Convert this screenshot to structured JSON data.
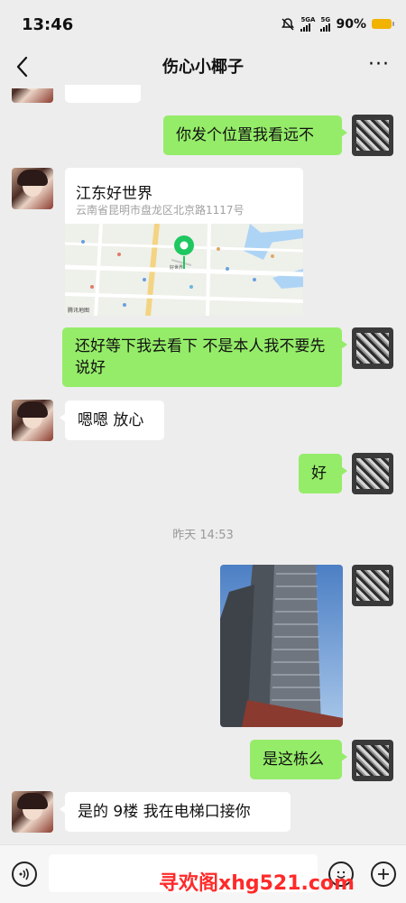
{
  "status_bar": {
    "time": "13:46",
    "network1": "5GA",
    "network2": "5G",
    "battery": "90%"
  },
  "header": {
    "title": "伤心小椰子",
    "more": "···"
  },
  "messages": {
    "m1": "你发个位置我看远不",
    "location": {
      "name": "江东好世界",
      "address": "云南省昆明市盘龙区北京路1117号",
      "map_labels": [
        "腾讯地图",
        "好世界"
      ]
    },
    "m2": "还好等下我去看下  不是本人我不要先说好",
    "m3": "嗯嗯 放心",
    "m4": "好",
    "timestamp": "昨天 14:53",
    "m5": "是这栋么",
    "m6": "是的  9楼 我在电梯口接你"
  },
  "watermark": "寻欢阁xhg521.com",
  "colors": {
    "sent_bubble": "#95ec69",
    "received_bubble": "#ffffff",
    "background": "#ededed",
    "watermark": "#ff2a2a",
    "map_pin": "#1ec760"
  }
}
